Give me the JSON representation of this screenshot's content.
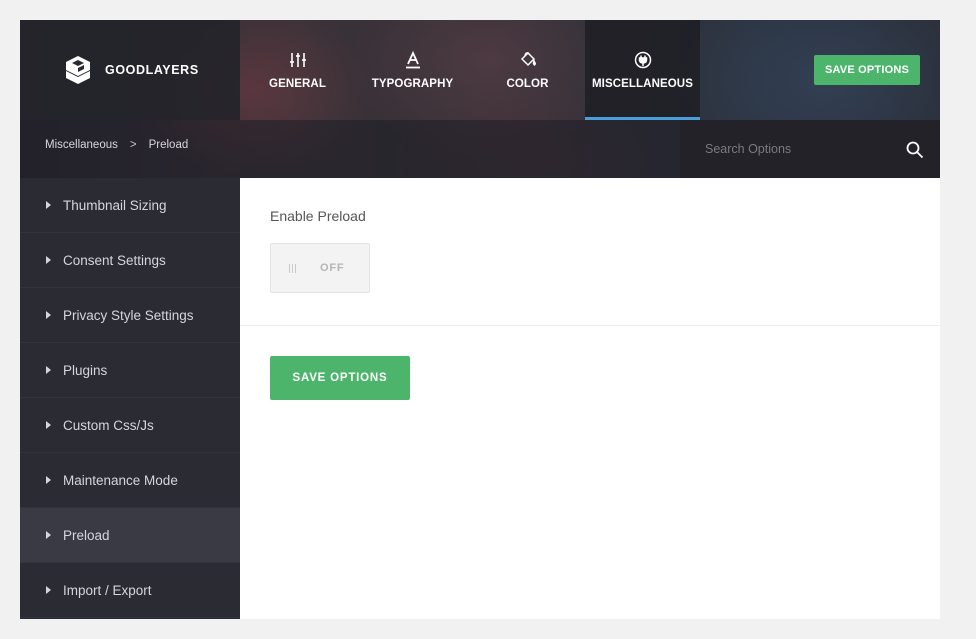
{
  "brand": {
    "name": "GOODLAYERS",
    "logo_icon": "goodlayers-logo-icon"
  },
  "tabs": [
    {
      "label": "GENERAL",
      "icon": "sliders-icon",
      "active": false
    },
    {
      "label": "TYPOGRAPHY",
      "icon": "typography-icon",
      "active": false
    },
    {
      "label": "COLOR",
      "icon": "paint-bucket-icon",
      "active": false
    },
    {
      "label": "MISCELLANEOUS",
      "icon": "plug-icon",
      "active": true
    }
  ],
  "header": {
    "save_label": "SAVE OPTIONS"
  },
  "breadcrumb": {
    "parent": "Miscellaneous",
    "separator": ">",
    "current": "Preload"
  },
  "search": {
    "placeholder": "Search Options",
    "value": ""
  },
  "sidebar": {
    "items": [
      {
        "label": "Thumbnail Sizing",
        "active": false
      },
      {
        "label": "Consent Settings",
        "active": false
      },
      {
        "label": "Privacy Style Settings",
        "active": false
      },
      {
        "label": "Plugins",
        "active": false
      },
      {
        "label": "Custom Css/Js",
        "active": false
      },
      {
        "label": "Maintenance Mode",
        "active": false
      },
      {
        "label": "Preload",
        "active": true
      },
      {
        "label": "Import / Export",
        "active": false
      }
    ]
  },
  "main": {
    "field_label": "Enable Preload",
    "toggle_state": "OFF",
    "save_label": "SAVE OPTIONS"
  },
  "colors": {
    "accent_green": "#4db56b",
    "active_tab_underline": "#4a9fd9",
    "sidebar_bg": "#2b2b33"
  }
}
